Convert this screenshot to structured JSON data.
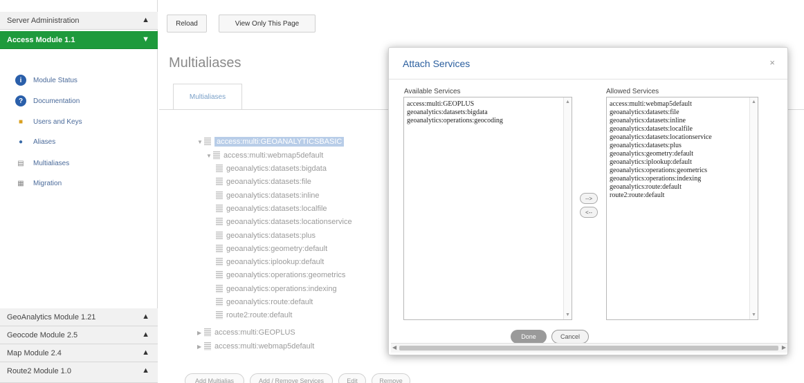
{
  "sidebar": {
    "server_admin": "Server Administration",
    "access_module": "Access Module 1.1",
    "items": [
      {
        "label": "Module Status",
        "icon": "info-icon"
      },
      {
        "label": "Documentation",
        "icon": "help-icon"
      },
      {
        "label": "Users and Keys",
        "icon": "lock-icon"
      },
      {
        "label": "Aliases",
        "icon": "user-icon"
      },
      {
        "label": "Multialiases",
        "icon": "document-icon"
      },
      {
        "label": "Migration",
        "icon": "migration-icon"
      }
    ],
    "modules": [
      {
        "label": "GeoAnalytics Module 1.21"
      },
      {
        "label": "Geocode Module 2.5"
      },
      {
        "label": "Map Module 2.4"
      },
      {
        "label": "Route2 Module 1.0"
      }
    ]
  },
  "toolbar": {
    "reload": "Reload",
    "view_only": "View Only This Page"
  },
  "main": {
    "title": "Multialiases",
    "tab": "Multialiases",
    "tree": {
      "root": "access:multi:GEOANALYTICSBASIC",
      "child": "access:multi:webmap5default",
      "leaves": [
        "geoanalytics:datasets:bigdata",
        "geoanalytics:datasets:file",
        "geoanalytics:datasets:inline",
        "geoanalytics:datasets:localfile",
        "geoanalytics:datasets:locationservice",
        "geoanalytics:datasets:plus",
        "geoanalytics:geometry:default",
        "geoanalytics:iplookup:default",
        "geoanalytics:operations:geometrics",
        "geoanalytics:operations:indexing",
        "geoanalytics:route:default",
        "route2:route:default"
      ],
      "siblings": [
        "access:multi:GEOPLUS",
        "access:multi:webmap5default"
      ]
    },
    "buttons": {
      "add": "Add Multialias",
      "add_remove": "Add / Remove Services",
      "edit": "Edit",
      "remove": "Remove"
    }
  },
  "modal": {
    "title": "Attach Services",
    "close": "×",
    "available_label": "Available Services",
    "allowed_label": "Allowed Services",
    "available": [
      "access:multi:GEOPLUS",
      "geoanalytics:datasets:bigdata",
      "geoanalytics:operations:geocoding"
    ],
    "allowed": [
      "access:multi:webmap5default",
      "geoanalytics:datasets:file",
      "geoanalytics:datasets:inline",
      "geoanalytics:datasets:localfile",
      "geoanalytics:datasets:locationservice",
      "geoanalytics:datasets:plus",
      "geoanalytics:geometry:default",
      "geoanalytics:iplookup:default",
      "geoanalytics:operations:geometrics",
      "geoanalytics:operations:indexing",
      "geoanalytics:route:default",
      "route2:route:default"
    ],
    "move_right": "-->",
    "move_left": "<--",
    "done": "Done",
    "cancel": "Cancel"
  }
}
